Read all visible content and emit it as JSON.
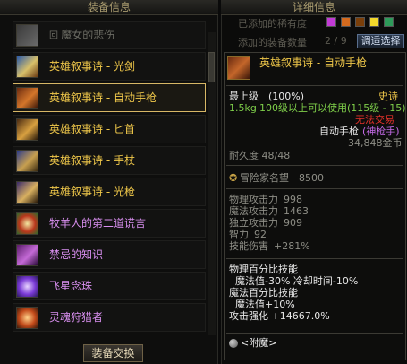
{
  "left": {
    "title": "装备信息",
    "items": [
      {
        "label": "魔女的悲伤",
        "rarity": "grey",
        "icon": "ring-icon"
      },
      {
        "label": "英雄叙事诗 - 光剑",
        "rarity": "epic",
        "icon": "lightsaber-icon"
      },
      {
        "label": "英雄叙事诗 - 自动手枪",
        "rarity": "epic",
        "icon": "pistol-icon",
        "selected": true
      },
      {
        "label": "英雄叙事诗 - 匕首",
        "rarity": "epic",
        "icon": "dagger-icon"
      },
      {
        "label": "英雄叙事诗 - 手杖",
        "rarity": "epic",
        "icon": "staff-icon"
      },
      {
        "label": "英雄叙事诗 - 光枪",
        "rarity": "epic",
        "icon": "lightgun-icon"
      },
      {
        "label": "牧羊人的第二道谎言",
        "rarity": "purple",
        "icon": "charm-icon"
      },
      {
        "label": "禁忌的知识",
        "rarity": "purple",
        "icon": "book-icon"
      },
      {
        "label": "飞星念珠",
        "rarity": "purple",
        "icon": "beads-icon"
      },
      {
        "label": "灵魂狩猎者",
        "rarity": "purple",
        "icon": "hunter-icon"
      }
    ],
    "equip_button": "装备交换"
  },
  "right": {
    "title": "详细信息",
    "rarity_label": "已添加的稀有度",
    "rarity_colors": [
      "#c23bd6",
      "#d46a1e",
      "#7a3f0a",
      "#f2d82c",
      "#2e9b5a"
    ],
    "count_label": "添加的装备数量",
    "count_value": "2 / 9",
    "filter_button": "调适选择",
    "item": {
      "name": "英雄叙事诗 - 自动手枪",
      "grade": "最上级",
      "grade_pct": "(100%)",
      "rarity": "史诗",
      "weight": "1.5kg",
      "level_req": "100级以上可以使用(115级 - 15)",
      "trade": "无法交易",
      "type": "自动手枪",
      "type_note": "(神枪手)",
      "price": "34,848金币",
      "durability": "耐久度 48/48",
      "adventurer": "冒险家名望",
      "adventurer_value": "8500",
      "stats": [
        {
          "name": "物理攻击力",
          "value": "998"
        },
        {
          "name": "魔法攻击力",
          "value": "1463"
        },
        {
          "name": "独立攻击力",
          "value": "909"
        },
        {
          "name": "智力",
          "value": "92"
        },
        {
          "name": "技能伤害",
          "value": "+281%"
        }
      ],
      "effects": [
        "物理百分比技能",
        "  魔法值-30% 冷却时间-10%",
        "魔法百分比技能",
        "  魔法值+10%",
        "攻击强化 +14667.0%"
      ],
      "enchant": "<附魔>"
    }
  }
}
